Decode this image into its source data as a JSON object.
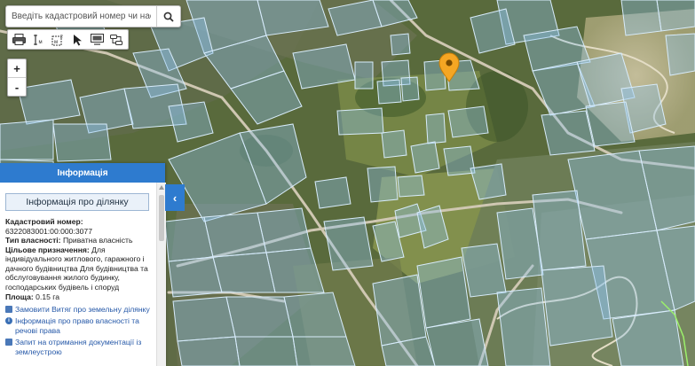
{
  "search": {
    "placeholder": "Введіть кадастровий номер чи насел"
  },
  "toolbar": {
    "tools": [
      "print-icon",
      "measure-length-icon",
      "measure-area-icon",
      "pointer-icon",
      "screen-icon",
      "layers-icon"
    ]
  },
  "zoom": {
    "in_label": "+",
    "out_label": "-"
  },
  "panel": {
    "header": "Інформація",
    "title": "Інформація про ділянку",
    "cadastral_label": "Кадастровий номер:",
    "cadastral_value": "6322083001:00:000:3077",
    "ownership_label": "Тип власності:",
    "ownership_value": "Приватна власність",
    "purpose_label": "Цільове призначення:",
    "purpose_value": "Для індивідуального житлового, гаражного і дачного будівництва Для будівництва та обслуговування жилого будинку, господарських будівель і споруд",
    "area_label": "Площа:",
    "area_value": "0.15 га",
    "links": [
      "Замовити Витяг про земельну ділянку",
      "Інформація про право власності та речові права",
      "Запит на отримання документації із землеустрою"
    ]
  },
  "collapse_label": "‹",
  "colors": {
    "accent": "#2e7bcf",
    "marker": "#f5a623",
    "parcel_fill": "#8fc3ec",
    "parcel_stroke": "#d8ecfb"
  }
}
